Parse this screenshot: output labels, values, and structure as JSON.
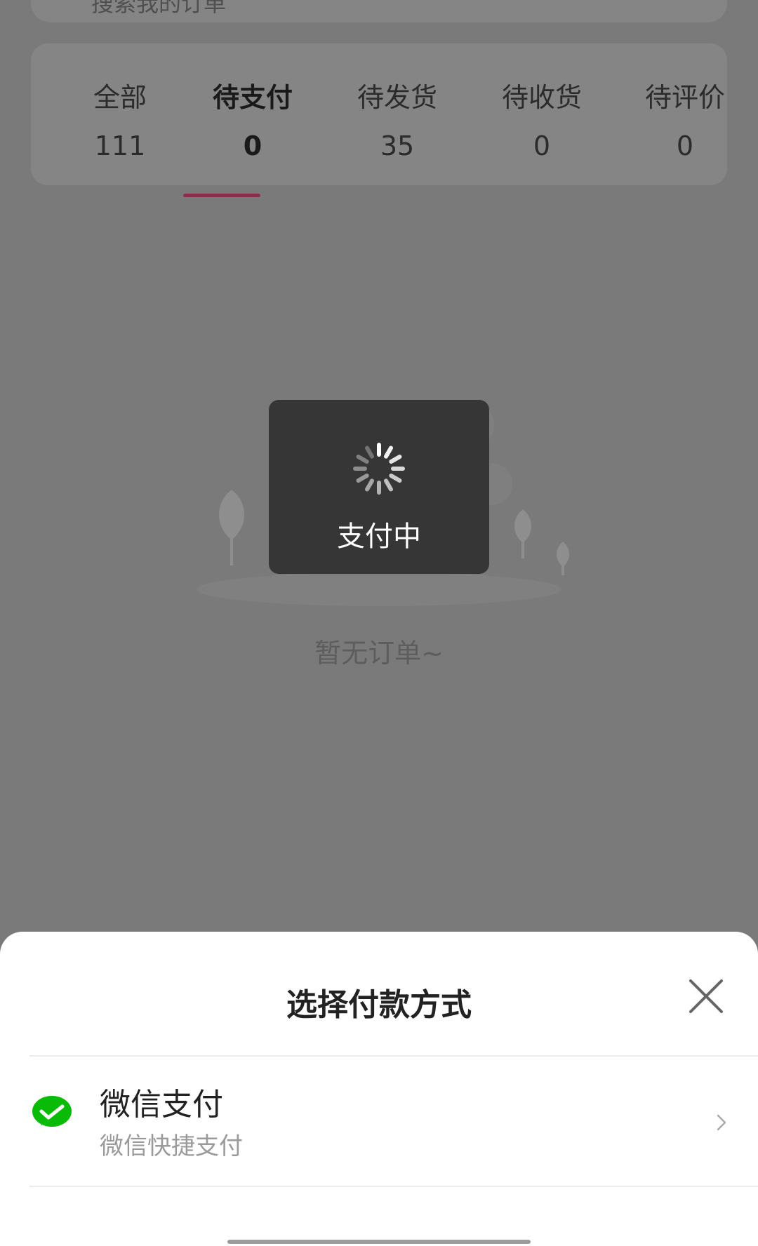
{
  "search": {
    "placeholder": "搜索我的订单"
  },
  "tabs": [
    {
      "label": "全部",
      "count": "111"
    },
    {
      "label": "待支付",
      "count": "0",
      "active": true
    },
    {
      "label": "待发货",
      "count": "35"
    },
    {
      "label": "待收货",
      "count": "0"
    },
    {
      "label": "待评价",
      "count": "0"
    }
  ],
  "empty": {
    "text": "暂无订单~"
  },
  "toast": {
    "text": "支付中",
    "icon": "spinner-icon"
  },
  "sheet": {
    "title": "选择付款方式",
    "close_icon": "close-icon",
    "options": [
      {
        "title": "微信支付",
        "subtitle": "微信快捷支付",
        "icon": "wechat-pay-icon"
      }
    ]
  },
  "colors": {
    "accent": "#8a2f4b",
    "wechat_green": "#09bb07",
    "overlay": "#7a7a7a"
  }
}
